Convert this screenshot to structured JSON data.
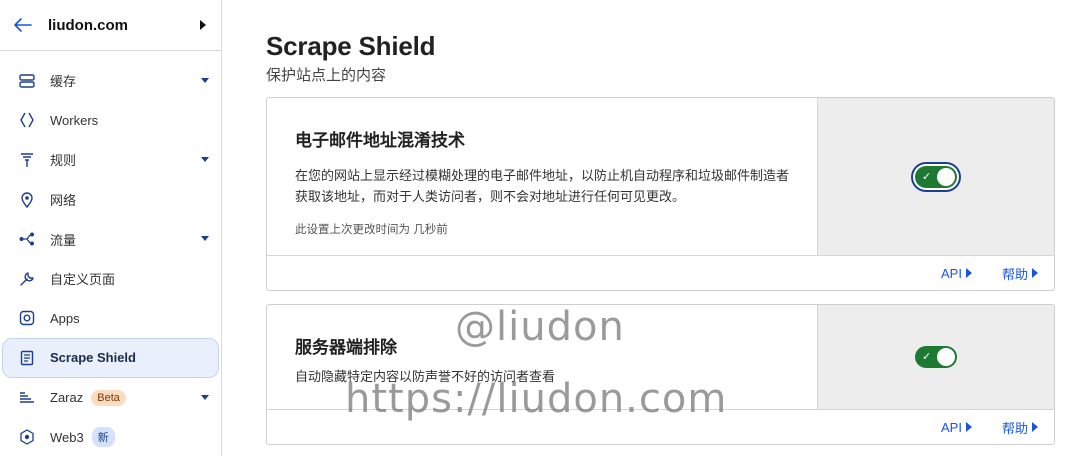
{
  "sidebar": {
    "site_name": "liudon.com",
    "items": [
      {
        "label": "缓存",
        "icon": "storage-icon",
        "has_dropdown": true
      },
      {
        "label": "Workers",
        "icon": "workers-icon",
        "has_dropdown": false
      },
      {
        "label": "规则",
        "icon": "rules-icon",
        "has_dropdown": true
      },
      {
        "label": "网络",
        "icon": "location-pin-icon",
        "has_dropdown": false
      },
      {
        "label": "流量",
        "icon": "traffic-icon",
        "has_dropdown": true
      },
      {
        "label": "自定义页面",
        "icon": "wrench-icon",
        "has_dropdown": false
      },
      {
        "label": "Apps",
        "icon": "apps-icon",
        "has_dropdown": false
      },
      {
        "label": "Scrape Shield",
        "icon": "document-icon",
        "has_dropdown": false,
        "active": true
      },
      {
        "label": "Zaraz",
        "icon": "zaraz-icon",
        "has_dropdown": true,
        "badge": "Beta"
      },
      {
        "label": "Web3",
        "icon": "web3-icon",
        "has_dropdown": false,
        "badge": "新"
      }
    ]
  },
  "main": {
    "title": "Scrape Shield",
    "subtitle": "保护站点上的内容",
    "cards": [
      {
        "title": "电子邮件地址混淆技术",
        "description": "在您的网站上显示经过模糊处理的电子邮件地址，以防止机自动程序和垃圾邮件制造者获取该地址，而对于人类访问者，则不会对地址进行任何可见更改。",
        "meta": "此设置上次更改时间为 几秒前",
        "toggle_on": true,
        "api_label": "API",
        "help_label": "帮助"
      },
      {
        "title": "服务器端排除",
        "description": "自动隐藏特定内容以防声誉不好的访问者查看",
        "toggle_on": true,
        "api_label": "API",
        "help_label": "帮助"
      }
    ]
  },
  "watermark": {
    "line1": "@liudon",
    "line2": "https://liudon.com"
  },
  "colors": {
    "accent": "#1a56db",
    "toggle_on": "#1e7a33",
    "active_nav_bg": "#e9f0fb"
  }
}
